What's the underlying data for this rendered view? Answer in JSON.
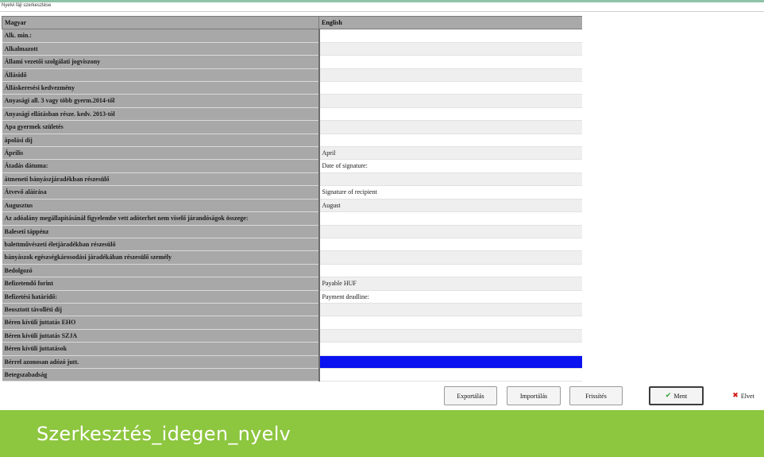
{
  "window": {
    "title": "Nyelvi fájl szerkesztése"
  },
  "grid": {
    "headers": {
      "col1": "Magyar",
      "col2": "English"
    },
    "rows": [
      {
        "hu": "Alk. min.:",
        "en": ""
      },
      {
        "hu": "Alkalmazott",
        "en": ""
      },
      {
        "hu": "Állami vezetői szolgálati jogviszony",
        "en": ""
      },
      {
        "hu": "Állásidő",
        "en": ""
      },
      {
        "hu": "Álláskeresési kedvezmény",
        "en": ""
      },
      {
        "hu": "Anyasági all. 3 vagy több gyerm.2014-től",
        "en": ""
      },
      {
        "hu": "Anyasági ellátásban része. kedv. 2013-tól",
        "en": ""
      },
      {
        "hu": "Apa gyermek születés",
        "en": ""
      },
      {
        "hu": "ápolási díj",
        "en": ""
      },
      {
        "hu": "Április",
        "en": "April"
      },
      {
        "hu": "Átadás dátuma:",
        "en": "Date of signature:"
      },
      {
        "hu": "átmeneti bányászjáradékban részesülő",
        "en": ""
      },
      {
        "hu": "Átvevő aláírása",
        "en": "Signature of recipient"
      },
      {
        "hu": "Augusztus",
        "en": "August"
      },
      {
        "hu": "Az adóalány megállapításánál figyelembe vett adóterhet nem viselő járandóságok összege:",
        "en": ""
      },
      {
        "hu": "Baleseti táppénz",
        "en": ""
      },
      {
        "hu": "balettművészeti életjáradékban részesülő",
        "en": ""
      },
      {
        "hu": "bányászok egészségkárosodási járadékában részesülő személy",
        "en": ""
      },
      {
        "hu": "Bedolgozó",
        "en": ""
      },
      {
        "hu": "Befizetendő forint",
        "en": "Payable HUF"
      },
      {
        "hu": "Befizetési határidő:",
        "en": "Payment deadline:"
      },
      {
        "hu": "Beosztott távolléti díj",
        "en": ""
      },
      {
        "hu": "Béren kívüli juttatás EHO",
        "en": ""
      },
      {
        "hu": "Béren kívüli juttatás SZJA",
        "en": ""
      },
      {
        "hu": "Béren kívüli juttatások",
        "en": ""
      },
      {
        "hu": "Bérrel azonosan adózó jutt.",
        "en": ""
      },
      {
        "hu": "Betegszabadság",
        "en": ""
      }
    ],
    "selected_row": 25
  },
  "buttons": {
    "export": "Exportálás",
    "import": "Importálás",
    "update": "Frissítés",
    "save": "Ment",
    "cancel": "Elvet"
  },
  "icons": {
    "save": "check-icon",
    "cancel": "x-icon"
  },
  "colors": {
    "selection": "#0a12f0",
    "banner": "#8dc63f",
    "save_check": "#2e9e2e",
    "cancel_x": "#d01818"
  },
  "banner": {
    "text": "Szerkesztés_idegen_nyelv"
  }
}
